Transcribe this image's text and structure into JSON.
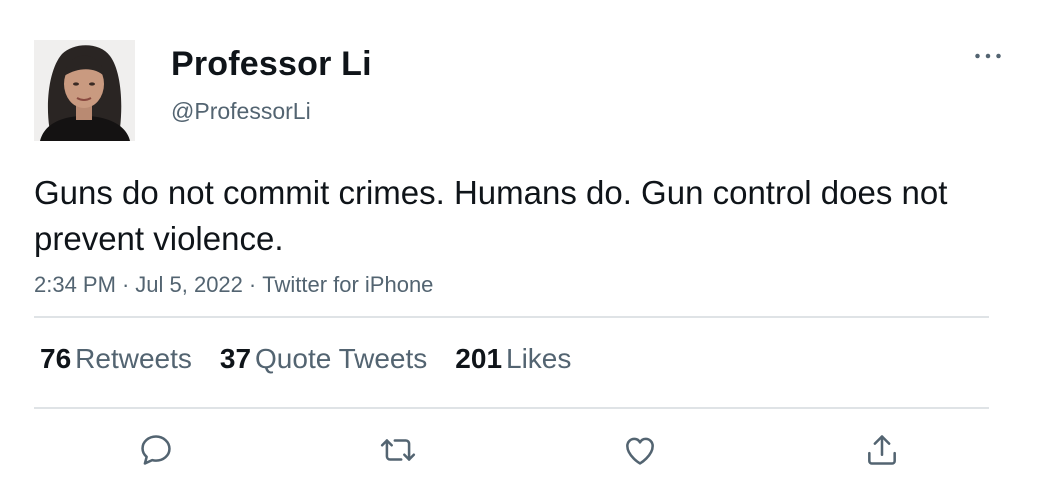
{
  "author": {
    "display_name": "Professor Li",
    "handle": "@ProfessorLi"
  },
  "tweet": {
    "text": "Guns do not commit crimes. Humans do. Gun control does not prevent violence.",
    "time": "2:34 PM",
    "date": "Jul 5, 2022",
    "source": "Twitter for iPhone",
    "separator": "·"
  },
  "stats": {
    "retweets": {
      "count": "76",
      "label": "Retweets"
    },
    "quote_tweets": {
      "count": "37",
      "label": "Quote Tweets"
    },
    "likes": {
      "count": "201",
      "label": "Likes"
    }
  },
  "actions": {
    "reply_icon": "reply-icon",
    "retweet_icon": "retweet-icon",
    "like_icon": "heart-icon",
    "share_icon": "share-icon"
  },
  "colors": {
    "text_primary": "#0f1419",
    "text_secondary": "#536471",
    "divider": "#dfe3e6"
  }
}
